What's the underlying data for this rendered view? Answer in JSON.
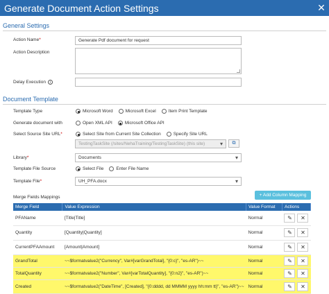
{
  "window": {
    "title": "Generate Document Action Settings",
    "close_icon": "close-icon"
  },
  "general": {
    "heading": "General Settings",
    "action_name_label": "Action Name",
    "action_name_value": "Generate Pdf document for request",
    "action_description_label": "Action Description",
    "delay_execution_label": "Delay Execution",
    "required_mark": "*"
  },
  "document": {
    "heading": "Document Template",
    "template_type_label": "Template Type",
    "template_type_options": [
      "Microsoft Word",
      "Microsoft Excel",
      "Item Print Template"
    ],
    "generate_with_label": "Generate document with",
    "generate_with_options": [
      "Open XML API",
      "Microsoft Office API"
    ],
    "source_site_label": "Select Source Site URL",
    "source_site_options": [
      "Select Site from Current Site Collection",
      "Specify Site URL"
    ],
    "source_site_value": "TestingTaskSite (/sites/NehaTraining/TestingTaskSite) (this site)",
    "library_label": "Library",
    "library_value": "Documents",
    "file_source_label": "Template File Source",
    "file_source_options": [
      "Select File",
      "Enter File Name"
    ],
    "template_file_label": "Template File",
    "template_file_value": "UH_PFA.docx"
  },
  "mappings": {
    "label": "Merge Fields Mappings",
    "add_button": "+ Add Column Mapping",
    "columns": [
      "Merge Field",
      "Value Expression",
      "Value Format",
      "Actions"
    ],
    "rows": [
      {
        "field": "PFAName",
        "expression": "[Title|Title]",
        "format": "Normal"
      },
      {
        "field": "Quantity",
        "expression": "[Quantity|Quantity]",
        "format": "Normal"
      },
      {
        "field": "CurrentPFAAmount",
        "expression": "[Amount|Amount]",
        "format": "Normal"
      },
      {
        "field": "GrandTotal",
        "expression": "~~$formatvalue2(\"Currency\", Var#[varGrandTotal], \"{0:c}\", \"es-AR\")~~",
        "format": "Normal"
      },
      {
        "field": "TotalQuantity",
        "expression": "~~$formatvalue2(\"Number\", Var#[varTotalQuantity], \"{0:n2}\", \"es-AR\")~~",
        "format": "Normal"
      },
      {
        "field": "Created",
        "expression": "~~$formatvalue2(\"DateTime\", [Created], \"{0:dddd, dd MMMM yyyy hh:mm tt}\", \"es-AR\")~~",
        "format": "Normal"
      }
    ],
    "highlight_color": "#fff86b"
  },
  "colors": {
    "accent": "#2b6cb0",
    "add_button": "#5bc0de"
  }
}
